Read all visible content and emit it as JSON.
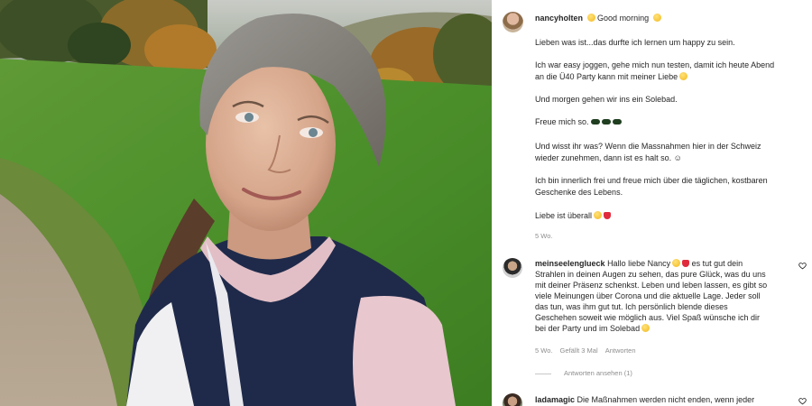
{
  "post": {
    "username": "nancyholten",
    "header_text": "Good morning",
    "caption": [
      "Lieben was ist...das durfte ich lernen um happy zu sein.",
      "Ich war easy joggen, gehe mich nun testen, damit ich heute Abend",
      "an die Ü40 Party kann mit meiner Liebe",
      "Und morgen gehen wir ins ein Solebad.",
      "Freue mich so.",
      "Und wisst ihr was? Wenn die Massnahmen hier in der Schweiz",
      "wieder zunehmen, dann ist es halt so. ☺",
      "Ich bin innerlich frei und freue mich über die täglichen, kostbaren",
      "Geschenke des Lebens.",
      "Liebe ist überall"
    ],
    "time": "5 Wo."
  },
  "comments": [
    {
      "username": "meinseelenglueck",
      "lines": [
        "Hallo liebe Nancy",
        "es tut gut dein",
        "Strahlen in deinen Augen zu sehen, das pure Glück, was du uns",
        "mit deiner Präsenz schenkst. Leben und leben lassen, es gibt so",
        "viele Meinungen über Corona und die aktuelle Lage. Jeder soll",
        "das tun, was ihm gut tut. Ich persönlich blende dieses",
        "Geschehen soweit wie möglich aus. Viel Spaß wünsche ich dir",
        "bei der Party und im Solebad"
      ],
      "time": "5 Wo.",
      "likes": "Gefällt 3 Mal",
      "reply": "Antworten",
      "view_replies": "Antworten ansehen (1)"
    },
    {
      "username": "ladamagic",
      "text": "Die Maßnahmen werden nicht enden, wenn jeder"
    }
  ],
  "colors": {
    "text": "#262626",
    "muted": "#8e8e8e",
    "heart": "#e02b3d"
  },
  "icons": [
    "heart-outline-icon",
    "avatar-nancyholten",
    "avatar-meinseelenglueck",
    "avatar-ladamagic"
  ]
}
